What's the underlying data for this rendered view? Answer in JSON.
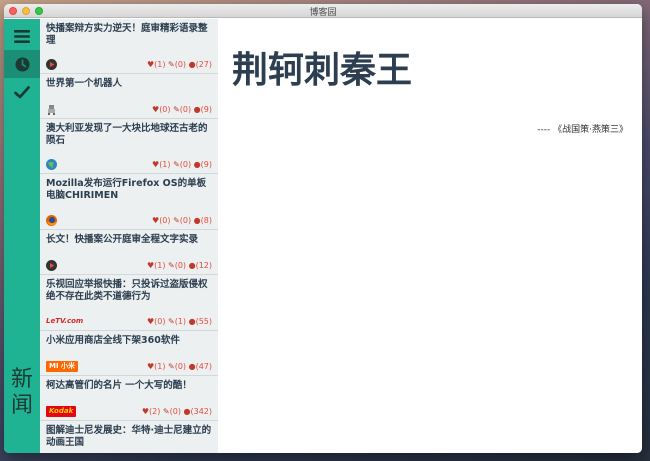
{
  "window": {
    "title": "博客园"
  },
  "rail": {
    "label": "新闻",
    "buttons": [
      {
        "name": "menu",
        "icon": "hamburger-icon"
      },
      {
        "name": "recent",
        "icon": "clock-icon"
      },
      {
        "name": "done",
        "icon": "check-icon"
      }
    ]
  },
  "news": [
    {
      "title": "快播案辩方实力逆天！庭审精彩语录整理",
      "logo": "qvod",
      "likes": "(1)",
      "comments": "(0)",
      "views": "(27)"
    },
    {
      "title": "世界第一个机器人",
      "logo": "robot",
      "likes": "(0)",
      "comments": "(0)",
      "views": "(9)"
    },
    {
      "title": "澳大利亚发现了一大块比地球还古老的陨石",
      "logo": "globe",
      "likes": "(1)",
      "comments": "(0)",
      "views": "(9)"
    },
    {
      "title": "Mozilla发布运行Firefox OS的单板电脑CHIRIMEN",
      "logo": "firefox",
      "likes": "(0)",
      "comments": "(0)",
      "views": "(8)"
    },
    {
      "title": "长文！快播案公开庭审全程文字实录",
      "logo": "qvod",
      "likes": "(1)",
      "comments": "(0)",
      "views": "(12)"
    },
    {
      "title": "乐视回应举报快播：只投诉过盗版侵权绝不存在此类不道德行为",
      "logo": "letv",
      "logo_text": "LeTV.com",
      "likes": "(0)",
      "comments": "(1)",
      "views": "(55)"
    },
    {
      "title": "小米应用商店全线下架360软件",
      "logo": "mi",
      "logo_text": "MI 小米",
      "likes": "(1)",
      "comments": "(0)",
      "views": "(47)"
    },
    {
      "title": "柯达高管们的名片 一个大写的酷！",
      "logo": "kodak",
      "logo_text": "Kodak",
      "likes": "(2)",
      "comments": "(0)",
      "views": "(342)"
    },
    {
      "title": "图解迪士尼发展史：华特·迪士尼建立的动画王国",
      "logo": "",
      "likes": "",
      "comments": "",
      "views": ""
    }
  ],
  "article": {
    "title": "荆轲刺秦王",
    "source": "---- 《战国策·燕策三》"
  },
  "colors": {
    "rail": "#1fb394",
    "rail_active": "#1a8f76",
    "accent": "#e74c3c",
    "title": "#2c3e50"
  }
}
